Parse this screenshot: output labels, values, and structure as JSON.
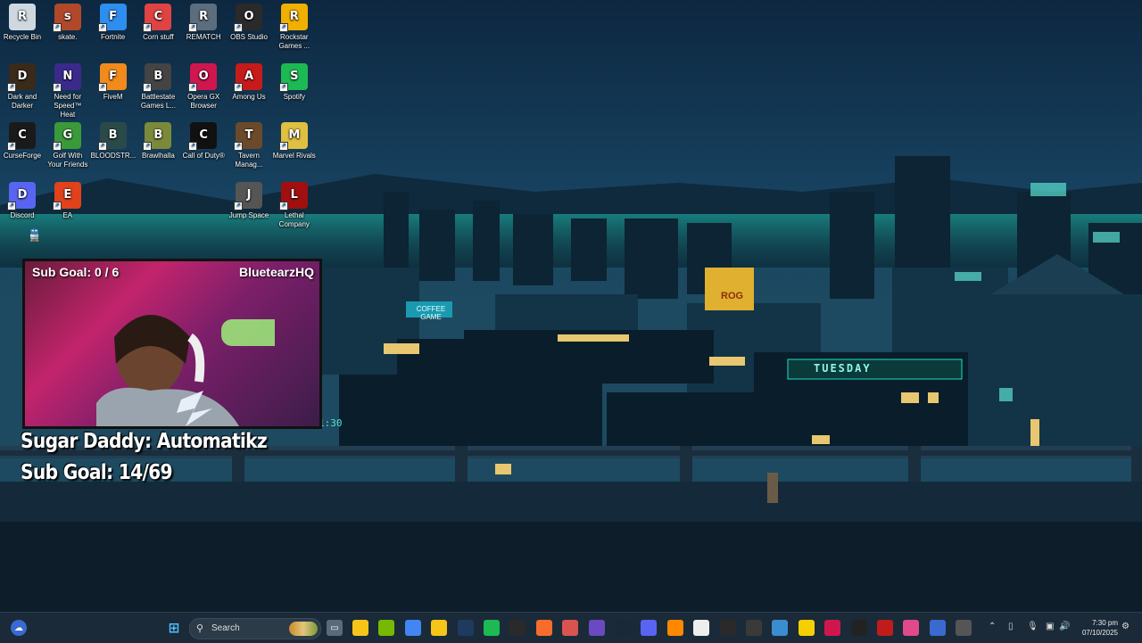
{
  "desktop_icons": [
    {
      "label": "Recycle Bin",
      "icon": "recycle-bin-icon",
      "color": "#cfd8e0"
    },
    {
      "label": "skate.",
      "icon": "skate-icon",
      "color": "#b0492a"
    },
    {
      "label": "Fortnite",
      "icon": "fortnite-icon",
      "color": "#2d8ef0"
    },
    {
      "label": "Corn stuff",
      "icon": "corn-stuff-icon",
      "color": "#e04343"
    },
    {
      "label": "REMATCH",
      "icon": "rematch-icon",
      "color": "#5c6e7d"
    },
    {
      "label": "OBS Studio",
      "icon": "obs-icon",
      "color": "#2a2a2a"
    },
    {
      "label": "Rockstar Games ...",
      "icon": "rockstar-icon",
      "color": "#f0b000"
    },
    {
      "label": "Dark and Darker",
      "icon": "dark-and-darker-icon",
      "color": "#3a2a1a"
    },
    {
      "label": "Need for Speed™ Heat",
      "icon": "nfs-icon",
      "color": "#3b2a8c"
    },
    {
      "label": "FiveM",
      "icon": "fivem-icon",
      "color": "#f28a1c"
    },
    {
      "label": "Battlestate Games L...",
      "icon": "battlestate-icon",
      "color": "#444"
    },
    {
      "label": "Opera GX Browser",
      "icon": "opera-gx-icon",
      "color": "#d0164f"
    },
    {
      "label": "Among Us",
      "icon": "among-us-icon",
      "color": "#c61b1b"
    },
    {
      "label": "Spotify",
      "icon": "spotify-icon",
      "color": "#1db954"
    },
    {
      "label": "CurseForge",
      "icon": "curseforge-icon",
      "color": "#1a1a1a"
    },
    {
      "label": "Golf With Your Friends",
      "icon": "golf-icon",
      "color": "#3a9a3a"
    },
    {
      "label": "BLOODSTR...",
      "icon": "bloodstrike-icon",
      "color": "#2a4a4a"
    },
    {
      "label": "Brawlhalla",
      "icon": "brawlhalla-icon",
      "color": "#7a8a3a"
    },
    {
      "label": "Call of Duty®",
      "icon": "call-of-duty-icon",
      "color": "#111"
    },
    {
      "label": "Tavern Manag...",
      "icon": "tavern-icon",
      "color": "#6a4a2a"
    },
    {
      "label": "Marvel Rivals",
      "icon": "marvel-rivals-icon",
      "color": "#e0c040"
    },
    {
      "label": "Discord",
      "icon": "discord-icon",
      "color": "#5865f2"
    },
    {
      "label": "EA",
      "icon": "ea-icon",
      "color": "#e0421c"
    },
    {
      "label": "Jump Space",
      "icon": "jump-space-icon",
      "color": "#555"
    },
    {
      "label": "Lethal Company",
      "icon": "lethal-company-icon",
      "color": "#a01010"
    }
  ],
  "stream_overlay": {
    "cam_sub_goal": "Sub Goal: 0 / 6",
    "channel_name": "BluetearzHQ",
    "overlay_line1": "Sugar Daddy: Automatikz",
    "overlay_line2": "Sub Goal: 14/69"
  },
  "wallpaper": {
    "billboard_day": "TUESDAY",
    "billboard_coffee": "COFFEE GAME",
    "sign_text": "ROG",
    "clock_sign": "1:30"
  },
  "taskbar": {
    "search_placeholder": "Search",
    "time": "7:30 pm",
    "date": "07/10/2025",
    "pinned": [
      {
        "icon": "file-explorer-icon",
        "color": "#f5c518"
      },
      {
        "icon": "nvidia-icon",
        "color": "#76b900"
      },
      {
        "icon": "chrome-icon",
        "color": "#4285f4"
      },
      {
        "icon": "folder-icon",
        "color": "#f5c518"
      },
      {
        "icon": "v-app-icon",
        "color": "#1e3a5f"
      },
      {
        "icon": "spotify-icon",
        "color": "#1db954"
      },
      {
        "icon": "epic-games-icon",
        "color": "#2a2a2a"
      },
      {
        "icon": "origin-icon",
        "color": "#f56c2d"
      },
      {
        "icon": "snip-tool-icon",
        "color": "#d9534f"
      },
      {
        "icon": "game-icon",
        "color": "#6a4ac0"
      },
      {
        "icon": "steam-icon",
        "color": "#1b2838"
      },
      {
        "icon": "discord-icon",
        "color": "#5865f2"
      },
      {
        "icon": "vlc-icon",
        "color": "#ff8800"
      },
      {
        "icon": "capcut-icon",
        "color": "#eee"
      },
      {
        "icon": "xbox-bar-icon",
        "color": "#2a2a2a"
      },
      {
        "icon": "obs-icon",
        "color": "#3a3a3a"
      },
      {
        "icon": "photos-icon",
        "color": "#3a8ed0"
      },
      {
        "icon": "sticky-notes-icon",
        "color": "#f5d000"
      },
      {
        "icon": "opera-gx-icon",
        "color": "#d0164f"
      },
      {
        "icon": "terminal-icon",
        "color": "#222"
      },
      {
        "icon": "lethal-icon",
        "color": "#c01c1c"
      },
      {
        "icon": "f-app-icon",
        "color": "#e04a8a"
      },
      {
        "icon": "vpn-icon",
        "color": "#3a6ad0"
      },
      {
        "icon": "keyboard-icon",
        "color": "#555"
      }
    ]
  },
  "colors": {
    "taskbar_bg": "#1b2a38",
    "accent": "#00d4c8"
  }
}
